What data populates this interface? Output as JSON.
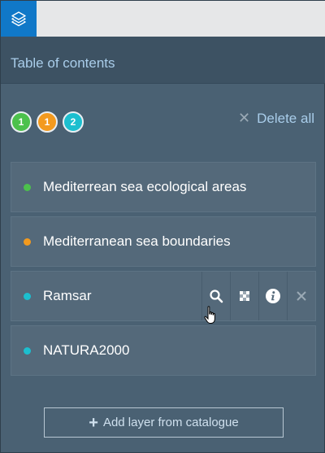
{
  "header": {
    "title": "Table of contents"
  },
  "badges": [
    {
      "label": "1",
      "color": "#4cc14c"
    },
    {
      "label": "1",
      "color": "#f39a1e"
    },
    {
      "label": "2",
      "color": "#1cbfcf"
    }
  ],
  "toolbar": {
    "delete_all_label": "Delete all"
  },
  "layers": [
    {
      "name": "Mediterrean sea ecological areas",
      "color": "#4cc14c"
    },
    {
      "name": "Mediterranean sea boundaries",
      "color": "#f39a1e"
    },
    {
      "name": "Ramsar",
      "color": "#1cbfcf"
    },
    {
      "name": "NATURA2000",
      "color": "#1cbfcf"
    }
  ],
  "layer_tools": [
    "search-icon",
    "opacity-icon",
    "info-icon",
    "close-icon"
  ],
  "footer": {
    "add_layer_label": "Add layer from catalogue"
  },
  "colors": {
    "accent": "#1078c8",
    "panel": "#4a6173"
  }
}
